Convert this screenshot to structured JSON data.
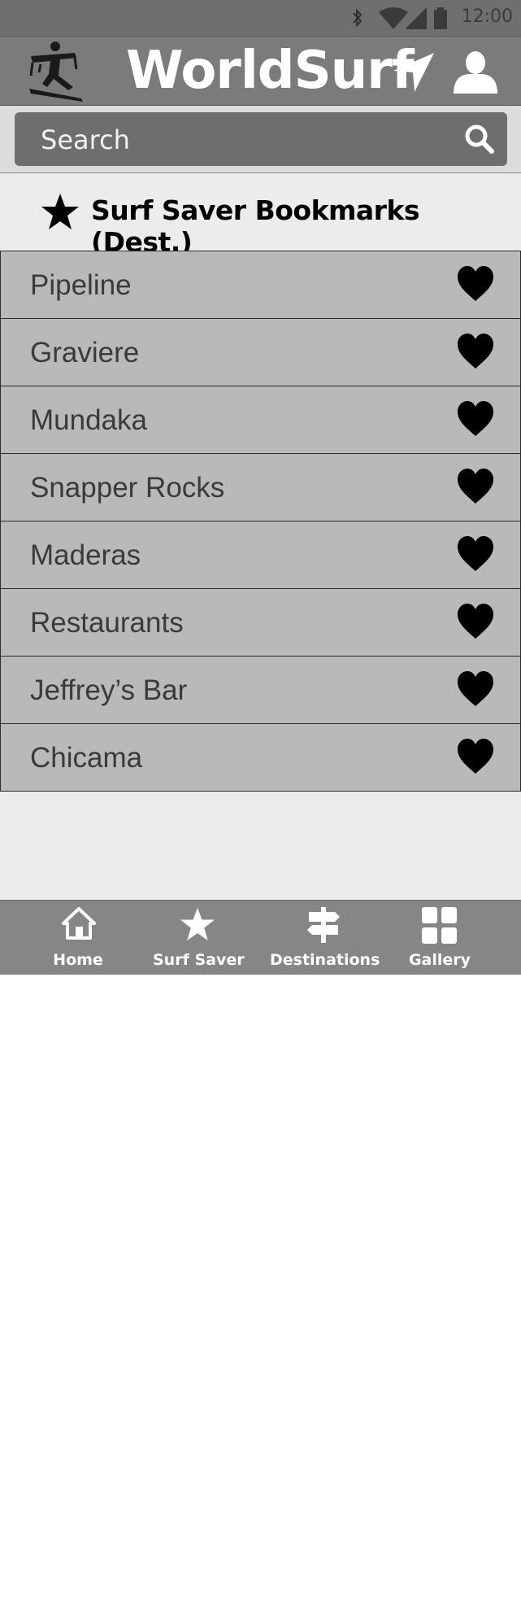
{
  "status_bar": {
    "time": "12:00",
    "icons": [
      "bluetooth-icon",
      "wifi-icon",
      "signal-icon",
      "battery-icon"
    ]
  },
  "header": {
    "title": "WorldSurf",
    "icons": [
      "surfer-logo-icon",
      "location-arrow-icon",
      "user-profile-icon"
    ]
  },
  "search": {
    "placeholder": "Search",
    "icon": "search-icon"
  },
  "section": {
    "title": "Surf Saver Bookmarks (Dest.)",
    "icon": "star-icon"
  },
  "bookmarks": [
    {
      "label": "Pipeline"
    },
    {
      "label": "Graviere"
    },
    {
      "label": "Mundaka"
    },
    {
      "label": "Snapper Rocks"
    },
    {
      "label": "Maderas"
    },
    {
      "label": "Restaurants"
    },
    {
      "label": "Jeffrey’s Bar"
    },
    {
      "label": "Chicama"
    }
  ],
  "bottom_nav": {
    "tabs": [
      {
        "label": "Home",
        "icon": "home-icon"
      },
      {
        "label": "Surf Saver",
        "icon": "star-icon"
      },
      {
        "label": "Destinations",
        "icon": "signpost-icon"
      },
      {
        "label": "Gallery",
        "icon": "grid-icon"
      }
    ]
  },
  "colors": {
    "header": "#7b7b7b",
    "list_item": "#b9b9b9",
    "nav": "#868686"
  }
}
